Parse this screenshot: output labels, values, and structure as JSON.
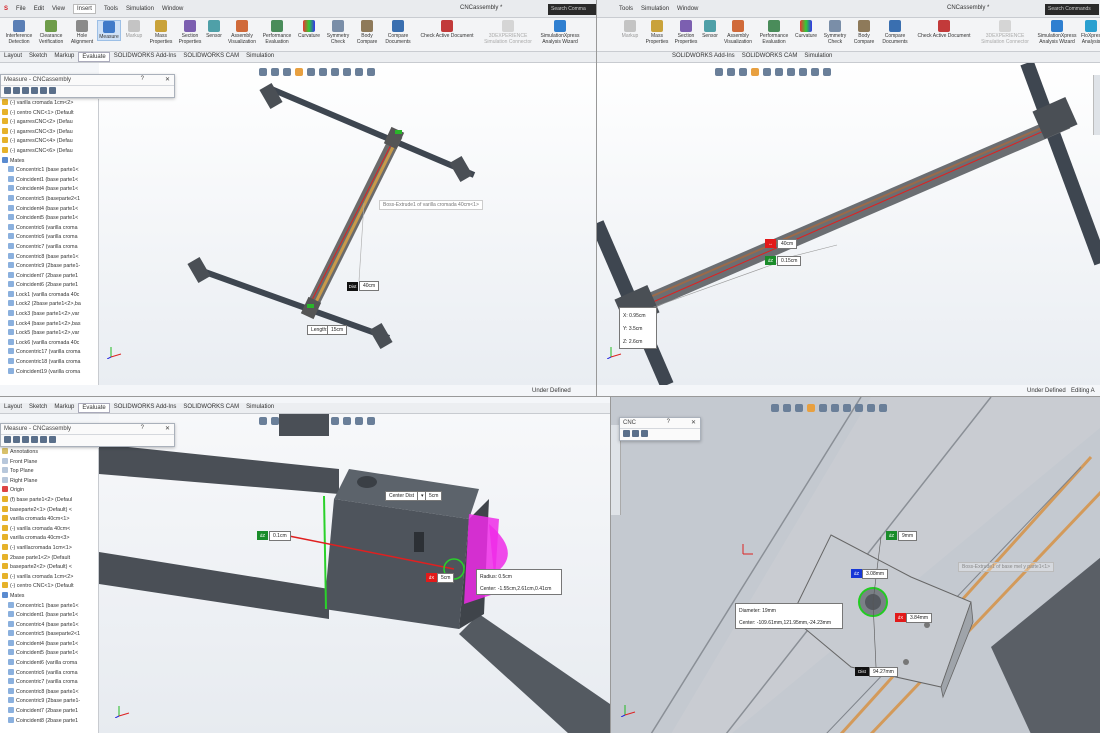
{
  "q1": {
    "menu": [
      "File",
      "Edit",
      "View",
      "Insert",
      "Tools",
      "Simulation",
      "Window"
    ],
    "doc_title": "CNCassembly *",
    "search_placeholder": "Search Comma",
    "ribbon": [
      "Interference Detection",
      "Clearance Verification",
      "Hole Alignment",
      "Measure",
      "Markup",
      "Mass Properties",
      "Section Properties",
      "Sensor",
      "Assembly Visualization",
      "Performance Evaluation",
      "Curvature",
      "Symmetry Check",
      "Body Compare",
      "Compare Documents",
      "Check Active Document",
      "3DEXPERIENCE Simulation Connector",
      "SimulationXpress Analysis Wizard"
    ],
    "tabs": [
      "Layout",
      "Sketch",
      "Markup",
      "Evaluate",
      "SOLIDWORKS Add-Ins",
      "SOLIDWORKS CAM",
      "Simulation"
    ],
    "measure_title": "Measure - CNCassembly",
    "tree": [
      "(-) varilla cromada 1cm<2>",
      "(-) centro CNC<1> (Default",
      "(-) agarresCNC<2> (Defau",
      "(-) agarresCNC<3> (Defau",
      "(-) agarresCNC<4> (Defau",
      "(-) agarresCNC<6> (Defau",
      "Mates",
      "Concentric1 (base parte1<",
      "Coincident1 (base parte1<",
      "Coincident4 (base parte1<",
      "Concentric5 (baseparte2<1",
      "Coincident4 (base parte1<",
      "Coincident5 (base parte1<",
      "Concentric6 (varilla croma",
      "Concentric6 (varilla croma",
      "Concentric7 (varilla croma",
      "Concentric8 (base parte1<",
      "Concentric9 (2base parte1-",
      "Coincident7 (2base parte1",
      "Coincident6 (2base parte1",
      "Lock1 (varilla cromada 40c",
      "Lock2 (2base parte1<2>,ba",
      "Lock3 (base parte1<2>,var",
      "Lock4 (base parte1<2>,bas",
      "Lock5 (base parte1<2>,var",
      "Lock6 (varilla cromada 40c",
      "Concentric17 (varilla croma",
      "Concentric18 (varilla croma",
      "Coincident19 (varilla croma"
    ],
    "callout_face": "Boss-Extrude1 of varilla cromada 40cm<1>",
    "dist_label": "Dist",
    "dist_value": "40cm",
    "length_label": "Length:",
    "length_value": "15cm",
    "status": "Under Defined"
  },
  "q2": {
    "menu": [
      "Tools",
      "Simulation",
      "Window"
    ],
    "doc_title": "CNCassembly *",
    "search_placeholder": "Search Commands",
    "ribbon": [
      "Markup",
      "Mass Properties",
      "Section Properties",
      "Sensor",
      "Assembly Visualization",
      "Performance Evaluation",
      "Curvature",
      "Symmetry Check",
      "Body Compare",
      "Compare Documents",
      "Check Active Document",
      "3DEXPERIENCE Simulation Connector",
      "SimulationXpress Analysis Wizard",
      "FloXpress Analysis"
    ],
    "tabs": [
      "SOLIDWORKS Add-Ins",
      "SOLIDWORKS CAM",
      "Simulation"
    ],
    "dist_value": "40cm",
    "dz_value": "0.15cm",
    "x_value": "0.95cm",
    "y_value": "3.5cm",
    "z_value": "2.6cm",
    "status": "Under Defined",
    "status2": "Editing A"
  },
  "q3": {
    "tabs": [
      "Layout",
      "Sketch",
      "Markup",
      "Evaluate",
      "SOLIDWORKS Add-Ins",
      "SOLIDWORKS CAM",
      "Simulation"
    ],
    "measure_title": "Measure - CNCassembly",
    "tree": [
      "Annotations",
      "Front Plane",
      "Top Plane",
      "Right Plane",
      "Origin",
      "(f) base parte1<2> (Defaul",
      "baseparte2<1> (Default) <",
      "varilla cromada 40cm<1>",
      "(-) varilla cromada 40cm<",
      "varilla cromada 40cm<3>",
      "(-) varillacromada 1cm<1>",
      "2base parte1<2> (Default",
      "baseparte2<2> (Default) <",
      "(-) varilla cromada 1cm<2>",
      "(-) centro CNC<1> (Default",
      "Mates",
      "Concentric1 (base parte1<",
      "Coincident1 (base parte1<",
      "Concentric4 (base parte1<",
      "Concentric5 (baseparte2<1",
      "Coincident4 (base parte1<",
      "Coincident5 (base parte1<",
      "Coincident6 (varilla croma",
      "Concentric6 (varilla croma",
      "Concentric7 (varilla croma",
      "Concentric8 (base parte1<",
      "Concentric9 (2base parte1-",
      "Coincident7 (2base parte1",
      "Coincident8 (2base parte1"
    ],
    "center_dist_label": "Center Dist",
    "center_dist_value": "5cm",
    "dz_value": "0.1cm",
    "dx_value": "5cm",
    "radius_label": "Radius:",
    "radius_value": "0.5cm",
    "center_label": "Center:",
    "center_value": "-1.55cm,2.61cm,0.41cm"
  },
  "q4": {
    "measure_title": "CNC",
    "face_callout": "Boss-Extrude1 of base mel y parte1<1>",
    "dz_value": "9mm",
    "dz_blue_value": "3.08mm",
    "dx_value": "3.84mm",
    "dist_label": "Dist",
    "dist_value": "94.27mm",
    "diameter_label": "Diameter:",
    "diameter_value": "19mm",
    "center_label": "Center:",
    "center_value": "-109.61mm,121.95mm,-24.23mm"
  }
}
